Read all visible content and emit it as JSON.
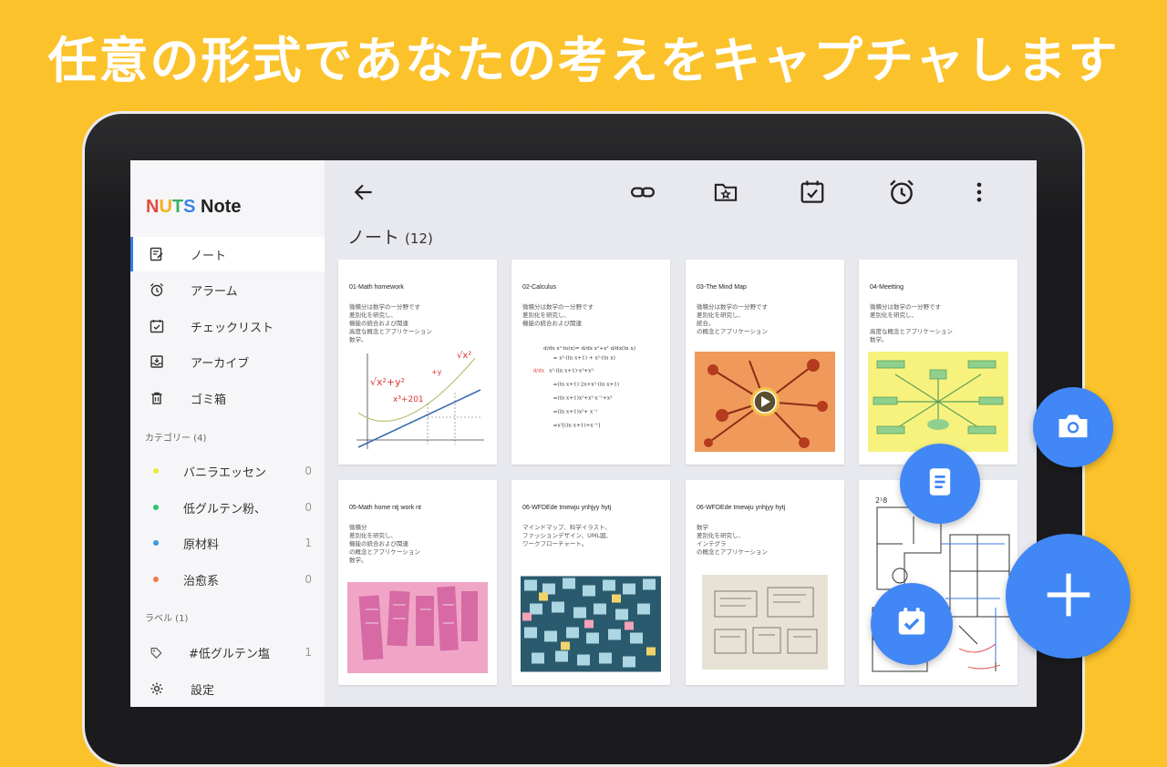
{
  "headline": "任意の形式であなたの考えをキャプチャします",
  "brand": {
    "n": "N",
    "u": "U",
    "t": "T",
    "s": "S",
    "rest": " Note"
  },
  "colors": {
    "background": "#FCC22B",
    "accent": "#4187f5",
    "active": "#3a78e8"
  },
  "sidebar": {
    "nav": [
      {
        "label": "ノート",
        "icon": "note-edit-icon",
        "active": true
      },
      {
        "label": "アラーム",
        "icon": "alarm-icon",
        "active": false
      },
      {
        "label": "チェックリスト",
        "icon": "checklist-icon",
        "active": false
      },
      {
        "label": "アーカイブ",
        "icon": "archive-icon",
        "active": false
      },
      {
        "label": "ゴミ箱",
        "icon": "trash-icon",
        "active": false
      }
    ],
    "categories_header": "カテゴリー (4)",
    "categories": [
      {
        "label": "バニラエッセン",
        "count": "0",
        "color": "#f2e93a"
      },
      {
        "label": "低グルテン粉、",
        "count": "0",
        "color": "#2bc46d"
      },
      {
        "label": "原材料",
        "count": "1",
        "color": "#3a9be0"
      },
      {
        "label": "治愈系",
        "count": "0",
        "color": "#f07a4a"
      }
    ],
    "labels_header": "ラベル (1)",
    "labels": [
      {
        "label": "#低グルテン塩",
        "count": "1",
        "icon": "tag-icon"
      }
    ],
    "settings": {
      "label": "設定",
      "icon": "gear-icon"
    }
  },
  "toolbar": {
    "back": "back-arrow-icon",
    "actions": [
      "link-icon",
      "folder-star-icon",
      "calendar-check-icon",
      "alarm-clock-icon",
      "more-vert-icon"
    ]
  },
  "list": {
    "title": "ノート",
    "count": "(12)"
  },
  "notes": [
    {
      "title": "01-Math homework",
      "body": "微積分は数学の一分野です\n差別化を研究し、\n機能の統合および関連\n高度な概念とアプリケーション\n数学。",
      "image": "graph"
    },
    {
      "title": "02-Calculus",
      "body": "微積分は数学の一分野です\n差別化を研究し、\n機能の統合および関連",
      "image": "equations"
    },
    {
      "title": "03-The Mind Map",
      "body": "微積分は数学の一分野です\n差別化を研究し、\n統合。\nの概念とアプリケーション",
      "image": "mindmap-video"
    },
    {
      "title": "04-Meetting",
      "body": "微積分は数学の一分野です\n差別化を研究し、\n\n高度な概念とアプリケーション\n数学。",
      "image": "yellow-diagram"
    },
    {
      "title": "05-Math home ntj work nt",
      "body": "微積分\n差別化を研究し、\n機能の統合および関連\nの概念とアプリケーション\n数学。",
      "image": "pink-sketch"
    },
    {
      "title": "06-WFDEde tmewju ynhjyy hytj",
      "body": "マインドマップ、科学イラスト、\nファッションデザイン、UML図、\nワークフローチャート。",
      "image": "sticky-notes"
    },
    {
      "title": "06-WFDEde tmewju ynhjyy hytj",
      "body": "数学\n差別化を研究し、\nインテグラ\nの概念とアプリケーション",
      "image": "paper-sketch"
    },
    {
      "title": "",
      "body": "",
      "image": "floorplan"
    }
  ],
  "fabs": [
    {
      "name": "camera",
      "icon": "camera-icon"
    },
    {
      "name": "text-note",
      "icon": "document-icon"
    },
    {
      "name": "checklist",
      "icon": "calendar-check-icon"
    },
    {
      "name": "add",
      "icon": "plus-icon"
    }
  ]
}
